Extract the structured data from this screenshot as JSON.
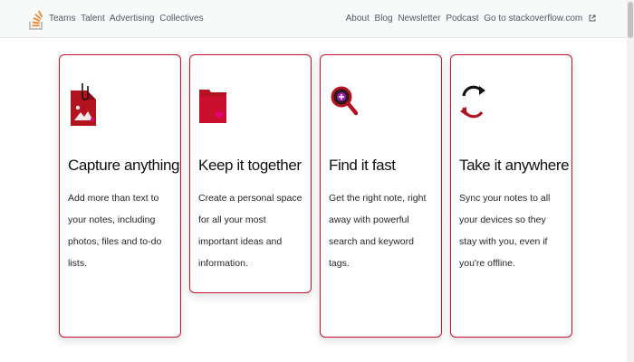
{
  "topbar": {
    "left_links": [
      "Teams",
      "Talent",
      "Advertising",
      "Collectives"
    ],
    "right_links": [
      "About",
      "Blog",
      "Newsletter",
      "Podcast",
      "Go to stackoverflow.com"
    ]
  },
  "icons": {
    "logo": "stackoverflow-logo",
    "external": "external-link-icon"
  },
  "colors": {
    "accent": "#c8102e",
    "logo_orange": "#f48024"
  },
  "cards": [
    {
      "icon": "attachment-image-icon",
      "title": "Capture anything",
      "desc": "Add more than text to your notes, including photos, files and to-do lists."
    },
    {
      "icon": "folder-heart-icon",
      "title": "Keep it together",
      "desc": "Create a personal space for all your most important ideas and information."
    },
    {
      "icon": "magnifier-icon",
      "title": "Find it fast",
      "desc": "Get the right note, right away with powerful search and keyword tags."
    },
    {
      "icon": "sync-arrows-icon",
      "title": "Take it anywhere",
      "desc": "Sync your notes to all your devices so they stay with you, even if you're offline."
    }
  ]
}
